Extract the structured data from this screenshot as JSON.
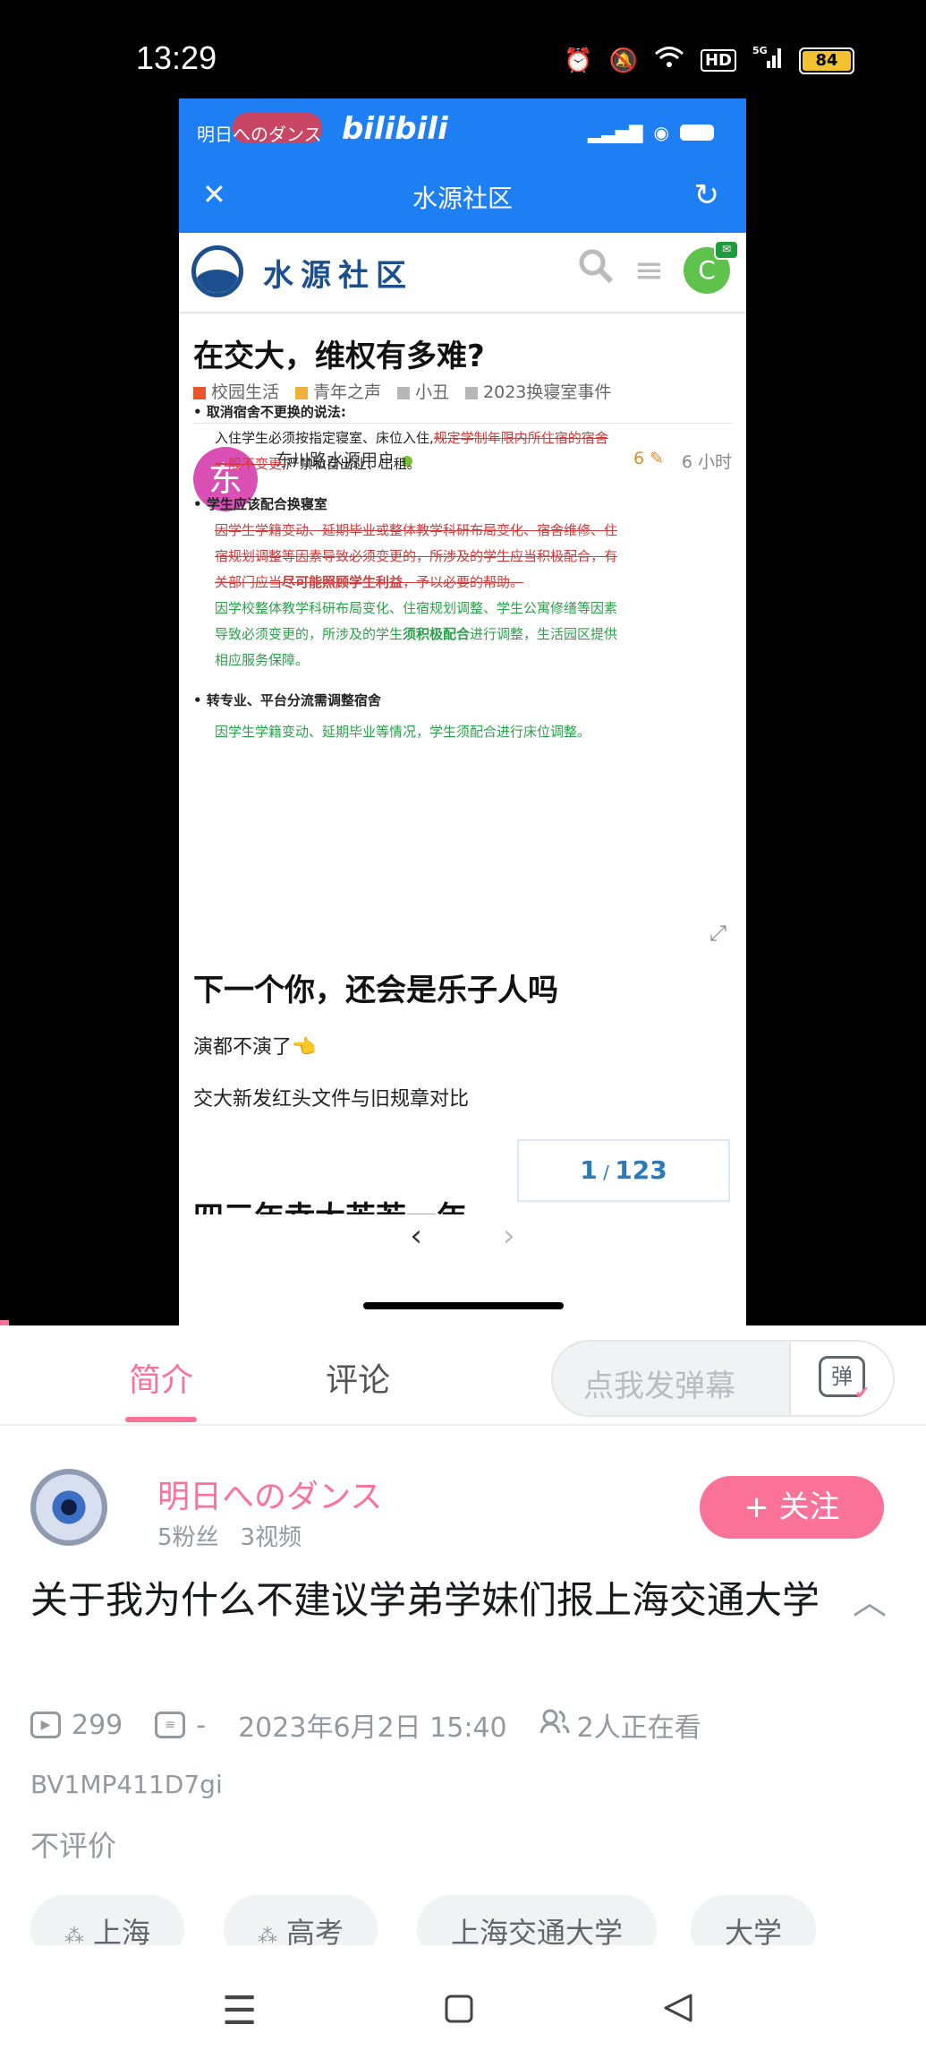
{
  "status_bar": {
    "time": "13:29",
    "network": "5G",
    "hd": "HD",
    "battery": "84"
  },
  "inner_app": {
    "owner_watermark": "明日へのダンス",
    "brand": "bilibili",
    "title": "水源社区",
    "close_icon": "close-icon",
    "reload_icon": "reload-icon",
    "forum": {
      "name": "水源社区",
      "user_initial": "C"
    },
    "post": {
      "title": "在交大，维权有多难?",
      "categories": [
        {
          "label": "校园生活",
          "color": "#e8552a"
        },
        {
          "label": "青年之声",
          "color": "#f0b13a"
        },
        {
          "label": "小丑",
          "color": "#b7b7b7"
        },
        {
          "label": "2023换寝室事件",
          "color": "#b7b7b7"
        }
      ],
      "author_initial": "东",
      "author": "东川路水源用户",
      "edits": "6",
      "time": "6 小时",
      "doc": {
        "b1": "取消宿舍不更换的说法:",
        "b1_text_a": "入住学生必须按指定寝室、床位入住,",
        "b1_strike_a": "规定学制年限内所住宿的宿舍",
        "b1_strike_b": "一般不变更,",
        "b1_text_b": "严禁私自出让、出租。",
        "b2": "学生应该配合换寝室",
        "b2_strike_a": "因学生学籍变动、延期毕业或整体教学科研布局变化、宿舍维修、住",
        "b2_strike_b": "宿规划调整等因素导致必须变更的，所涉及的学生应当积极配合，有",
        "b2_strike_c": "关部门应当",
        "b2_strike_bold": "尽可能照顾学生利益",
        "b2_strike_d": "，予以必要的帮助。",
        "b2_green_a": "因学校整体教学科研布局变化、住宿规划调整、学生公寓修缮等因素",
        "b2_green_b": "导致必须变更的，所涉及的学生",
        "b2_green_bold": "须积极配合",
        "b2_green_c": "进行调整，生活园区提供",
        "b2_green_d": "相应服务保障。",
        "b3": "转专业、平台分流需调整宿舍",
        "b3_green": "因学生学籍变动、延期毕业等情况，学生须配合进行床位调整。"
      },
      "heading2": "下一个你，还会是乐子人吗",
      "line1": "演都不演了👈",
      "line2": "交大新发红头文件与旧规章对比",
      "cut_heading": "四三年幸大苦若一年",
      "progress_current": "1",
      "progress_total": "123"
    }
  },
  "tabs": {
    "intro": "简介",
    "comments": "评论",
    "danmaku_placeholder": "点我发弹幕",
    "danmaku_button": "弹"
  },
  "uploader": {
    "name": "明日へのダンス",
    "fans": "5粉丝",
    "videos": "3视频",
    "follow": "+ 关注"
  },
  "video": {
    "title": "关于我为什么不建议学弟学妹们报上海交通大学",
    "plays": "299",
    "danmaku_count": "-",
    "date": "2023年6月2日 15:40",
    "watching": "2人正在看",
    "bvid": "BV1MP411D7gi",
    "rating": "不评价",
    "tags": [
      "上海",
      "高考",
      "上海交通大学",
      "大学"
    ]
  },
  "navbar": {
    "menu_icon": "menu-icon",
    "home_icon": "home-square-icon",
    "back_icon": "back-triangle-icon"
  }
}
